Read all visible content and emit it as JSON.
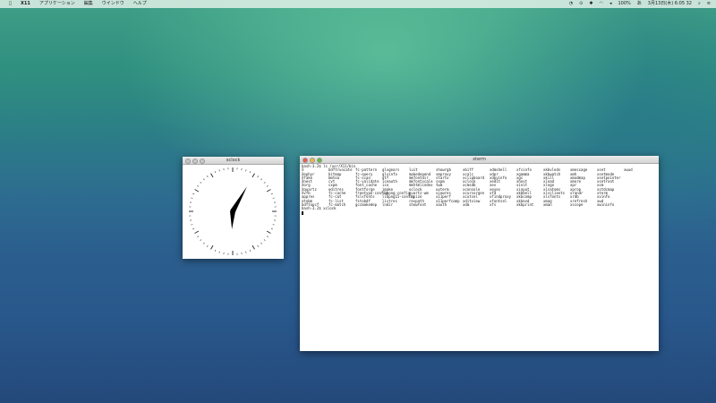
{
  "menubar": {
    "apple": "",
    "app": "X11",
    "menus": [
      "アプリケーション",
      "編集",
      "ウインドウ",
      "ヘルプ"
    ],
    "status": {
      "battery": "100%",
      "input": "あ",
      "datetime": "3月13日(木) 6:05 32"
    }
  },
  "clock_window": {
    "title": "xclock",
    "time": {
      "hour": 6,
      "minute": 5
    }
  },
  "terminal": {
    "title": "xterm",
    "command_line": "bash-3.2$ ls /usr/X11/bin",
    "columns": [
      [
        "X",
        "Xephyr",
        "Xfake",
        "Xnest",
        "Xorg",
        "Xquartz",
        "Xvfb",
        "appres",
        "atobm",
        "bdftopcf"
      ],
      [
        "bdftruncate",
        "bitmap",
        "bmtoa",
        "cvt",
        "cxpm",
        "editres",
        "fc-cache",
        "fc-cat",
        "fc-list",
        "fc-match"
      ],
      [
        "fc-pattern",
        "fc-query",
        "fc-scan",
        "fc-validate",
        "font_cache",
        "fontforge",
        "freetype-config",
        "fslsfonts",
        "fstobdf",
        "gccmakedep"
      ],
      [
        "glxgears",
        "glxinfo",
        "gtf",
        "iceauth",
        "ico",
        "imake",
        "libpng-config",
        "libpng15-config",
        "listres",
        "lndir"
      ],
      [
        "luit",
        "makedepend",
        "mkfontdir",
        "mkfontscale",
        "mkhtmlindex",
        "oclock",
        "quartz-wm",
        "resize",
        "revpath",
        "showfont"
      ],
      [
        "showrgb",
        "smproxy",
        "startx",
        "sxpm",
        "twm",
        "uxterm",
        "viewres",
        "x11perf",
        "x11perfcomp",
        "xauth"
      ],
      [
        "xbiff",
        "xcalc",
        "xclipboard",
        "xclock",
        "xcmsdb",
        "xconsole",
        "xcursorgen",
        "xcutsel",
        "xditview",
        "xdm"
      ],
      [
        "xdmshell",
        "xdpr",
        "xdpyinfo",
        "xedit",
        "xev",
        "xeyes",
        "xfd",
        "xfindproxy",
        "xfontsel",
        "xfs"
      ],
      [
        "xfsinfo",
        "xgamma",
        "xgc",
        "xhost",
        "xinit",
        "xinput",
        "xkbbell",
        "xkbcomp",
        "xkbevd",
        "xkbprint"
      ],
      [
        "xkbvleds",
        "xkbwatch",
        "xkill",
        "xload",
        "xlogo",
        "xlsatoms",
        "xlsclients",
        "xlsfonts",
        "xmag",
        "xman"
      ],
      [
        "xmessage",
        "xmh",
        "xmodmap",
        "xmore",
        "xpr",
        "xprop",
        "xrandr",
        "xrdb",
        "xrefresh",
        "xscope"
      ],
      [
        "xset",
        "xsetmode",
        "xsetpointer",
        "xsetroot",
        "xsm",
        "xstdcmap",
        "xterm",
        "xvinfo",
        "xwd",
        "xwininfo"
      ],
      [
        "xwud",
        "",
        "",
        "",
        "",
        "",
        "",
        "",
        "",
        ""
      ]
    ],
    "last_line": "bash-3.2$ xclock"
  }
}
